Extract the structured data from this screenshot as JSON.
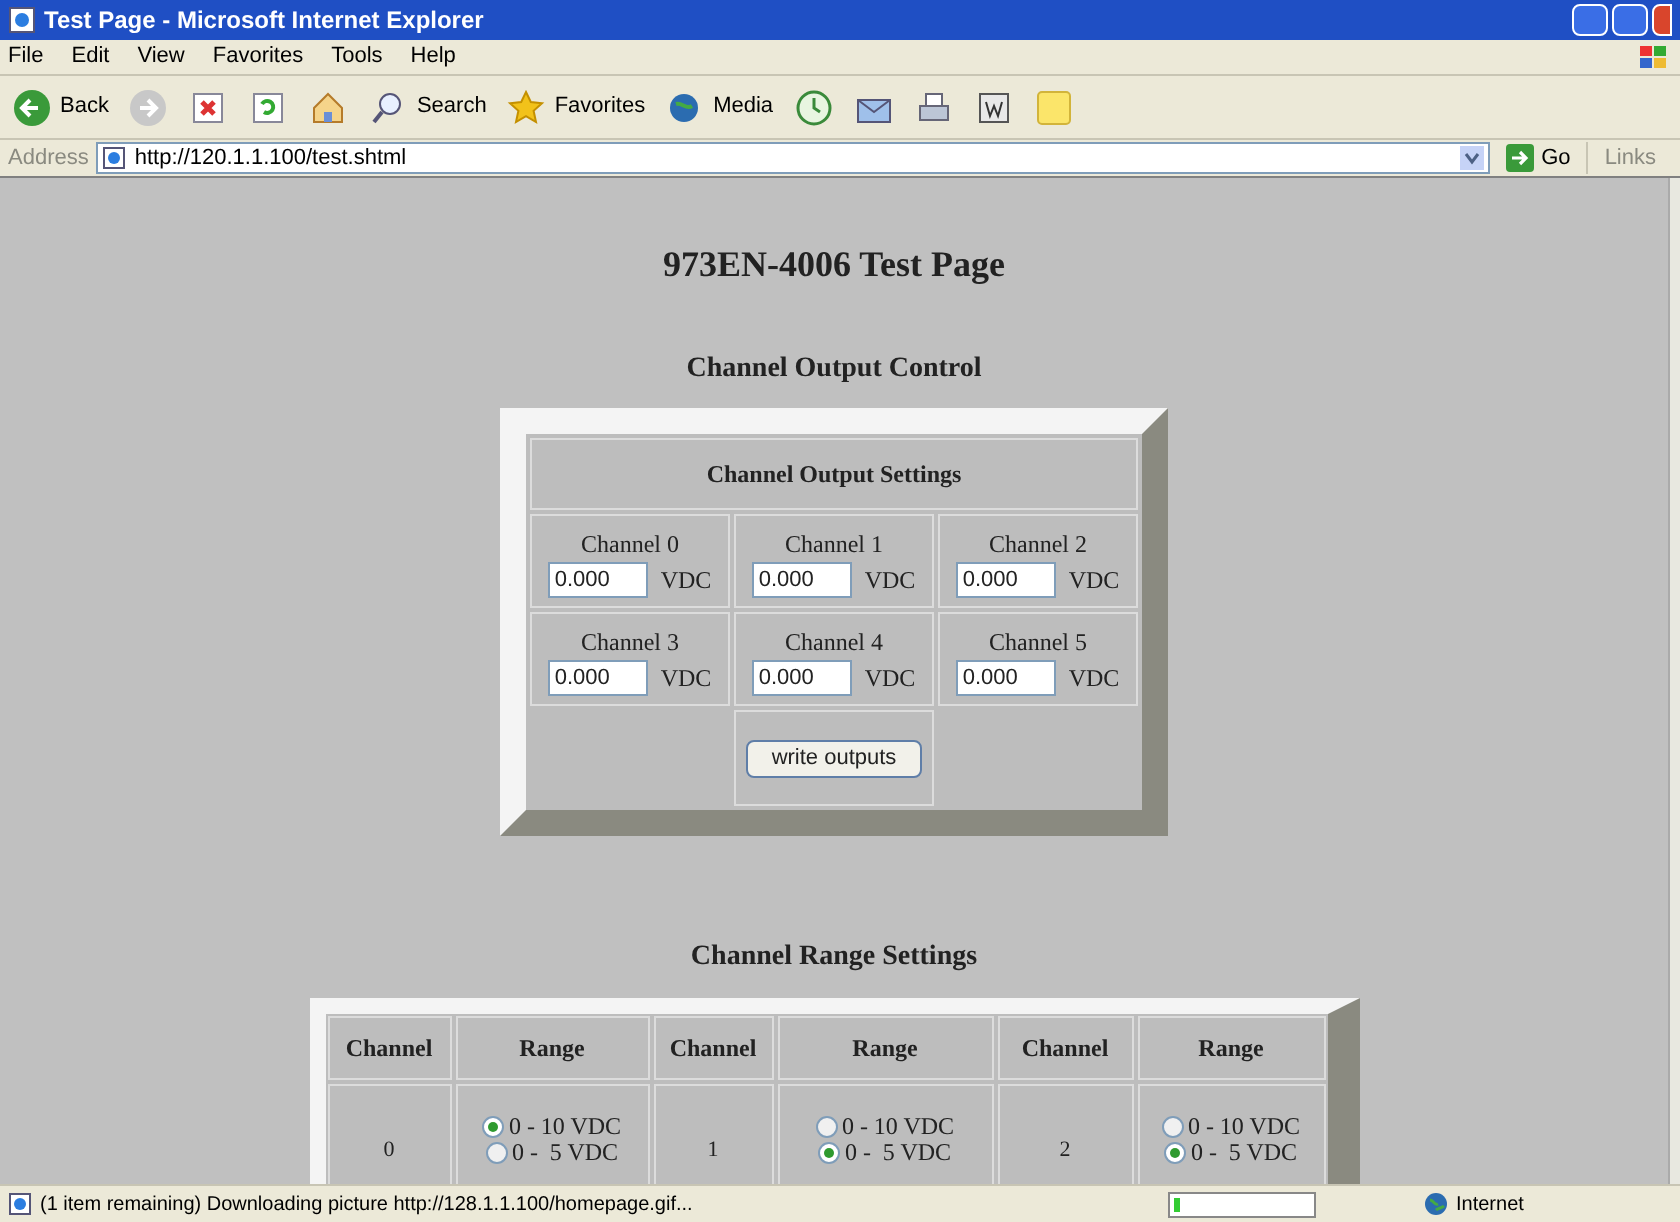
{
  "window": {
    "title": "Test Page - Microsoft Internet Explorer"
  },
  "menu": [
    "File",
    "Edit",
    "View",
    "Favorites",
    "Tools",
    "Help"
  ],
  "toolbar": [
    {
      "kind": "back",
      "label": "Back"
    },
    {
      "kind": "forward"
    },
    {
      "kind": "stop"
    },
    {
      "kind": "refresh"
    },
    {
      "kind": "home"
    },
    {
      "kind": "search",
      "label": "Search"
    },
    {
      "kind": "favorites",
      "label": "Favorites"
    },
    {
      "kind": "media",
      "label": "Media"
    },
    {
      "kind": "history"
    },
    {
      "kind": "mail"
    },
    {
      "kind": "print"
    },
    {
      "kind": "word"
    },
    {
      "kind": "note"
    }
  ],
  "address": {
    "label": "Address",
    "url": "http://120.1.1.100/test.shtml",
    "go": "Go",
    "links": "Links"
  },
  "page": {
    "heading": "973EN-4006 Test Page",
    "output_section": {
      "title": "Channel Output Control",
      "table_title": "Channel Output Settings",
      "channels": [
        {
          "label": "Channel 0",
          "value": "0.000",
          "unit": "VDC"
        },
        {
          "label": "Channel 1",
          "value": "0.000",
          "unit": "VDC"
        },
        {
          "label": "Channel 2",
          "value": "0.000",
          "unit": "VDC"
        },
        {
          "label": "Channel 3",
          "value": "0.000",
          "unit": "VDC"
        },
        {
          "label": "Channel 4",
          "value": "0.000",
          "unit": "VDC"
        },
        {
          "label": "Channel 5",
          "value": "0.000",
          "unit": "VDC"
        }
      ],
      "button": "write outputs"
    },
    "range_section": {
      "title": "Channel Range Settings",
      "columns": [
        "Channel",
        "Range",
        "Channel",
        "Range",
        "Channel",
        "Range"
      ],
      "channels": [
        {
          "channel": "0",
          "options": [
            {
              "label": "0 - 10 VDC",
              "selected": true
            },
            {
              "label": "0 -  5 VDC",
              "selected": false
            }
          ]
        },
        {
          "channel": "1",
          "options": [
            {
              "label": "0 - 10 VDC",
              "selected": false
            },
            {
              "label": "0 -  5 VDC",
              "selected": true
            }
          ]
        },
        {
          "channel": "2",
          "options": [
            {
              "label": "0 - 10 VDC",
              "selected": false
            },
            {
              "label": "0 -  5 VDC",
              "selected": true
            }
          ]
        }
      ]
    }
  },
  "status_bar": {
    "text": "(1 item remaining) Downloading picture http://128.1.1.100/homepage.gif...",
    "progress": {
      "level": 0.04
    },
    "zone": "Internet"
  }
}
